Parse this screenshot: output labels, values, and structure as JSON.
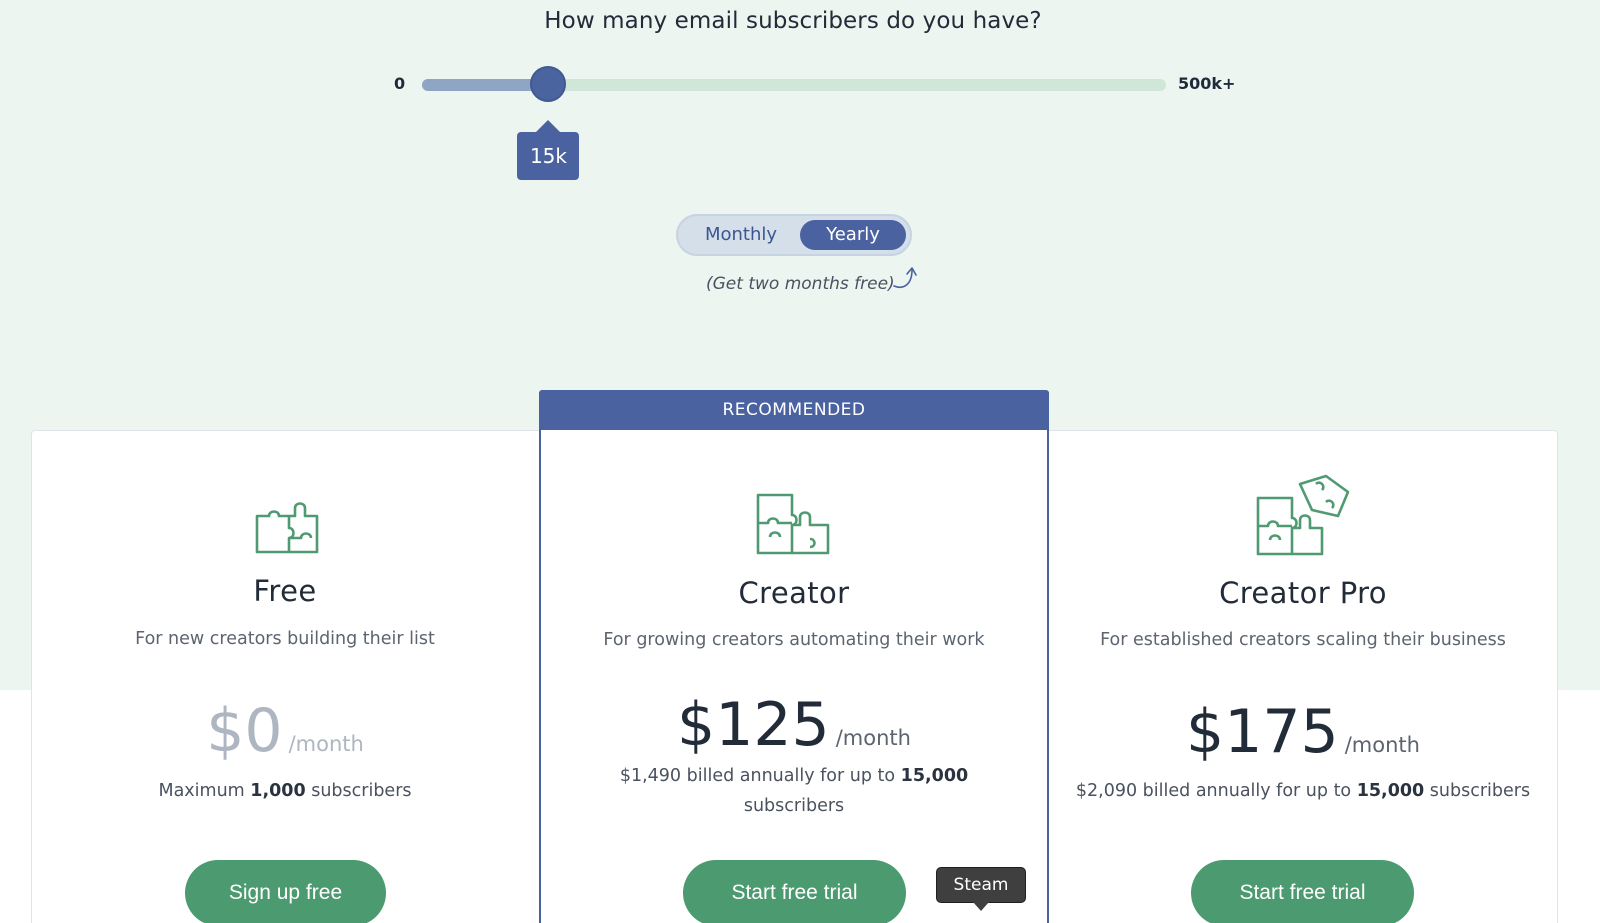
{
  "question": "How many email subscribers do you have?",
  "slider": {
    "min_label": "0",
    "max_label": "500k+",
    "value_label": "15k",
    "fill_fraction": 0.17
  },
  "billing_toggle": {
    "monthly_label": "Monthly",
    "yearly_label": "Yearly",
    "selected": "Yearly",
    "promo": "(Get two months free)"
  },
  "recommended_label": "RECOMMENDED",
  "plans": [
    {
      "name": "Free",
      "description": "For new creators building their list",
      "price": "$0",
      "unit": "/month",
      "billing_prefix": "Maximum ",
      "billing_bold": "1,000",
      "billing_suffix": " subscribers",
      "cta": "Sign up free",
      "icon": "puzzle-piece-icon"
    },
    {
      "name": "Creator",
      "description": "For growing creators automating their work",
      "price": "$125",
      "unit": "/month",
      "billing_prefix": "$1,490 billed annually for up to ",
      "billing_bold": "15,000",
      "billing_suffix": " subscribers",
      "cta": "Start free trial",
      "icon": "puzzle-pieces-icon"
    },
    {
      "name": "Creator Pro",
      "description": "For established creators scaling their business",
      "price": "$175",
      "unit": "/month",
      "billing_prefix": "$2,090 billed annually for up to ",
      "billing_bold": "15,000",
      "billing_suffix": " subscribers",
      "cta": "Start free trial",
      "icon": "puzzle-pieces-stacked-icon"
    }
  ],
  "tooltip": "Steam",
  "colors": {
    "accent_blue": "#4b62a0",
    "cta_green": "#4c9a70",
    "icon_green": "#4f9a72",
    "hero_bg": "#edf5f1"
  }
}
